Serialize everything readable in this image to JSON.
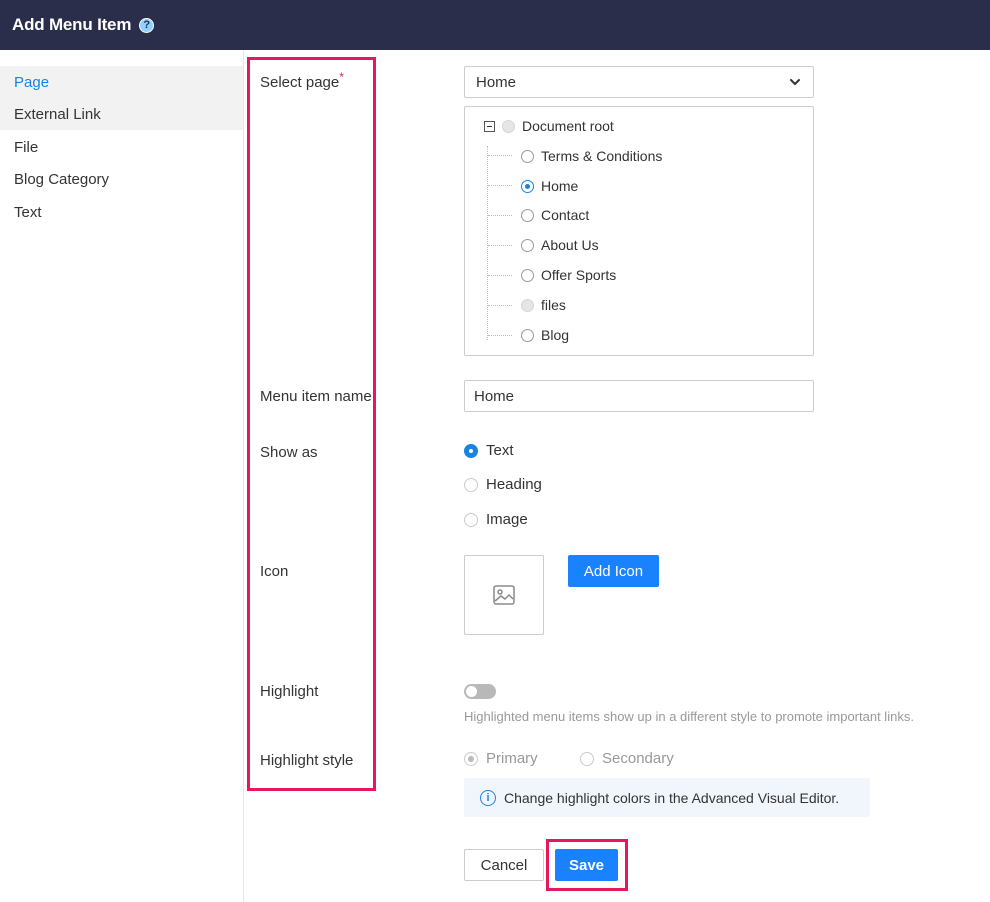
{
  "header": {
    "title": "Add Menu Item",
    "help_glyph": "?"
  },
  "sidebar": {
    "items": [
      {
        "label": "Page",
        "active": true
      },
      {
        "label": "External Link",
        "active": false
      },
      {
        "label": "File",
        "active": false
      },
      {
        "label": "Blog Category",
        "active": false
      },
      {
        "label": "Text",
        "active": false
      }
    ]
  },
  "form": {
    "select_page": {
      "label": "Select page",
      "required_mark": "*",
      "selected": "Home",
      "tree": {
        "root": "Document root",
        "items": [
          {
            "label": "Terms & Conditions",
            "checked": false,
            "disabled": false
          },
          {
            "label": "Home",
            "checked": true,
            "disabled": false
          },
          {
            "label": "Contact",
            "checked": false,
            "disabled": false
          },
          {
            "label": "About Us",
            "checked": false,
            "disabled": false
          },
          {
            "label": "Offer Sports",
            "checked": false,
            "disabled": false
          },
          {
            "label": "files",
            "checked": false,
            "disabled": true
          },
          {
            "label": "Blog",
            "checked": false,
            "disabled": false
          }
        ]
      }
    },
    "menu_item_name": {
      "label": "Menu item name",
      "value": "Home"
    },
    "show_as": {
      "label": "Show as",
      "options": [
        {
          "label": "Text",
          "checked": true
        },
        {
          "label": "Heading",
          "checked": false
        },
        {
          "label": "Image",
          "checked": false
        }
      ]
    },
    "icon": {
      "label": "Icon",
      "add_button": "Add Icon"
    },
    "highlight": {
      "label": "Highlight",
      "enabled": false,
      "hint": "Highlighted menu items show up in a different style to promote important links."
    },
    "highlight_style": {
      "label": "Highlight style",
      "options": [
        {
          "label": "Primary",
          "checked": true
        },
        {
          "label": "Secondary",
          "checked": false
        }
      ],
      "info_glyph": "i",
      "info": "Change highlight colors in the Advanced Visual Editor."
    }
  },
  "actions": {
    "cancel": "Cancel",
    "save": "Save"
  },
  "colors": {
    "header_bg": "#2b2e4a",
    "accent": "#1a82ff",
    "annotation": "#e8175d"
  }
}
